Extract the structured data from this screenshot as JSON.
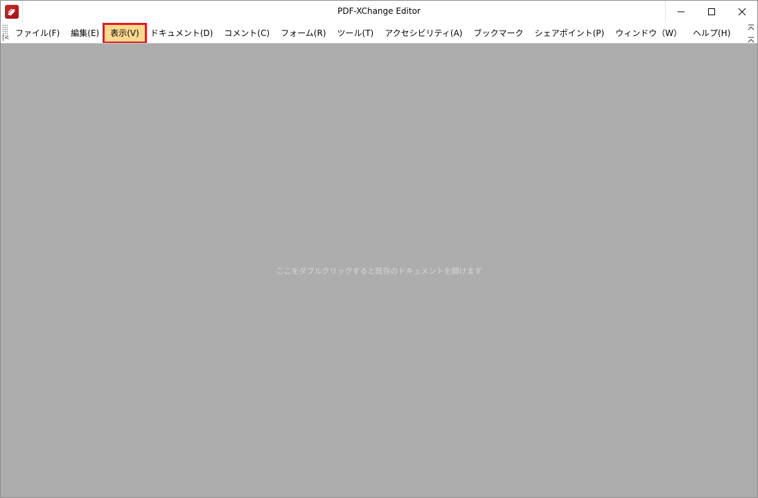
{
  "window": {
    "title": "PDF-XChange Editor"
  },
  "menu": {
    "items": [
      {
        "label": "ファイル(F)"
      },
      {
        "label": "編集(E)"
      },
      {
        "label": "表示(V)",
        "highlighted": true
      },
      {
        "label": "ドキュメント(D)"
      },
      {
        "label": "コメント(C)"
      },
      {
        "label": "フォーム(R)"
      },
      {
        "label": "ツール(T)"
      },
      {
        "label": "アクセシビリティ(A)"
      },
      {
        "label": "ブックマーク"
      },
      {
        "label": "シェアポイント(P)"
      },
      {
        "label": "ウィンドウ（W）"
      },
      {
        "label": "ヘルプ(H)"
      }
    ]
  },
  "workspace": {
    "hint": "ここをダブルクリックすると既存のドキュメントを開けます"
  },
  "colors": {
    "highlight_fill": "#fbd98f",
    "highlight_border": "#e01b24",
    "workspace_bg": "#adadad",
    "app_icon": "#c8202a"
  },
  "icons": {
    "app": "pdf-xchange-app-icon",
    "minimize": "minimize-icon",
    "maximize": "maximize-icon",
    "close": "close-icon",
    "collapse_left": "collapse-left-icon",
    "collapse_up": "collapse-up-icon"
  }
}
